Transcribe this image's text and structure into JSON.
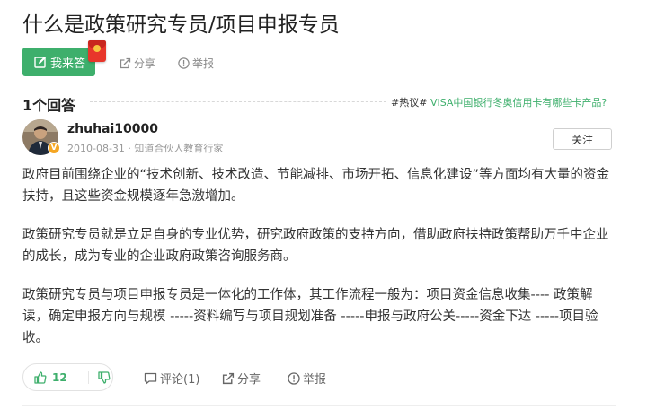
{
  "question": {
    "title": "什么是政策研究专员/项目申报专员",
    "answer_button": "我来答",
    "share": "分享",
    "report": "举报"
  },
  "answers_header": {
    "count": "1个回答",
    "hot_tag": "#热议#",
    "hot_link": "VISA中国银行冬奥信用卡有哪些卡产品?"
  },
  "answer": {
    "username": "zhuhai10000",
    "meta": "2010-08-31 · 知道合伙人教育行家",
    "follow": "关注",
    "badge": "V",
    "paragraphs": [
      "政府目前围绕企业的“技术创新、技术改造、节能减排、市场开拓、信息化建设”等方面均有大量的资金扶持，且这些资金规模逐年急激增加。",
      "政策研究专员就是立足自身的专业优势，研究政府政策的支持方向，借助政府扶持政策帮助万千中企业的成长，成为专业的企业政府政策咨询服务商。",
      "政策研究专员与项目申报专员是一体化的工作体，其工作流程一般为：项目资金信息收集---- 政策解读，确定申报方向与规模 -----资料编写与项目规划准备 -----申报与政府公关-----资金下达 -----项目验收。"
    ],
    "likes": "12",
    "comment": "评论(1)",
    "share": "分享",
    "report": "举报"
  },
  "colors": {
    "accent": "#3eaf6c",
    "text": "#333333",
    "muted": "#8a8a8a"
  },
  "icons": [
    "edit-icon",
    "red-packet-icon",
    "share-icon",
    "report-icon",
    "thumbs-up-icon",
    "thumbs-down-icon",
    "comment-icon"
  ]
}
